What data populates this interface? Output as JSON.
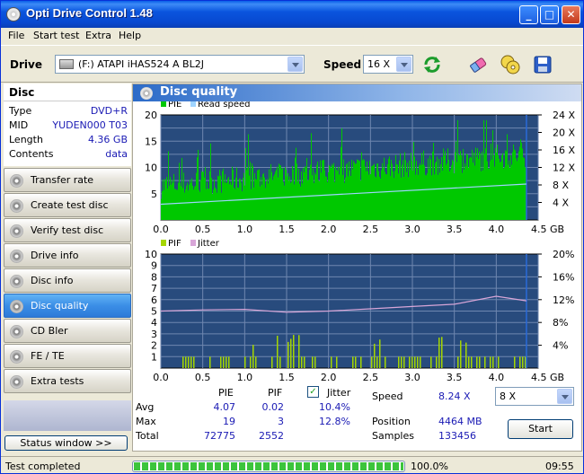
{
  "window": {
    "title": "Opti Drive Control 1.48",
    "minimize": "_",
    "maximize": "□",
    "close": "✕"
  },
  "menu": [
    "File",
    "Start test",
    "Extra",
    "Help"
  ],
  "toolbar": {
    "drive_label": "Drive",
    "drive_value": "(F:)  ATAPI iHAS524   A BL2J",
    "speed_label": "Speed",
    "speed_value": "16 X"
  },
  "disc": {
    "header": "Disc",
    "rows": [
      {
        "key": "Type",
        "value": "DVD+R"
      },
      {
        "key": "MID",
        "value": "YUDEN000 T03"
      },
      {
        "key": "Length",
        "value": "4.36 GB"
      },
      {
        "key": "Contents",
        "value": "data"
      }
    ]
  },
  "nav": [
    "Transfer rate",
    "Create test disc",
    "Verify test disc",
    "Drive info",
    "Disc info",
    "Disc quality",
    "CD Bler",
    "FE / TE",
    "Extra tests"
  ],
  "nav_active": "Disc quality",
  "status_window_button": "Status window >>",
  "panel_title": "Disc quality",
  "chart_data": [
    {
      "type": "bar",
      "legend": [
        "PIE",
        "Read speed"
      ],
      "colors": {
        "pie": "#00c800",
        "read_speed": "#9fd4ff",
        "background": "#284b7d",
        "grid": "#6f87b0"
      },
      "x_ticks": [
        "0.0",
        "0.5",
        "1.0",
        "1.5",
        "2.0",
        "2.5",
        "3.0",
        "3.5",
        "4.0",
        "4.5 GB"
      ],
      "y_left_ticks": [
        "20",
        "15",
        "10",
        "5"
      ],
      "y_right_ticks": [
        "24 X",
        "20 X",
        "16 X",
        "12 X",
        "8 X",
        "4 X"
      ],
      "xlim": [
        0,
        4.5
      ],
      "ylim": [
        0,
        20
      ],
      "y2lim": [
        0,
        24
      ],
      "read_speed": {
        "x": [
          0,
          4.36
        ],
        "y": [
          3.6,
          8.2
        ]
      }
    },
    {
      "type": "bar",
      "legend": [
        "PIF",
        "Jitter"
      ],
      "colors": {
        "pif": "#a5d600",
        "jitter": "#d8a6d8",
        "background": "#284b7d",
        "grid": "#6f87b0"
      },
      "x_ticks": [
        "0.0",
        "0.5",
        "1.0",
        "1.5",
        "2.0",
        "2.5",
        "3.0",
        "3.5",
        "4.0",
        "4.5 GB"
      ],
      "y_left_ticks": [
        "10",
        "9",
        "8",
        "7",
        "6",
        "5",
        "4",
        "3",
        "2",
        "1"
      ],
      "y_right_ticks": [
        "20%",
        "16%",
        "12%",
        "8%",
        "4%"
      ],
      "xlim": [
        0,
        4.5
      ],
      "ylim": [
        0,
        10
      ],
      "y2lim": [
        0,
        20
      ],
      "jitter": {
        "x": [
          0,
          0.5,
          1.0,
          1.5,
          2.0,
          2.5,
          3.0,
          3.5,
          4.0,
          4.36
        ],
        "y": [
          10.0,
          10.2,
          10.3,
          9.8,
          10.0,
          10.4,
          10.8,
          11.2,
          12.6,
          11.8
        ]
      }
    }
  ],
  "stats": {
    "col_pie": "PIE",
    "col_pif": "PIF",
    "col_jitter": "Jitter",
    "jitter_checked": "✓",
    "rows": [
      {
        "label": "Avg",
        "pie": "4.07",
        "pif": "0.02",
        "jitter": "10.4%"
      },
      {
        "label": "Max",
        "pie": "19",
        "pif": "3",
        "jitter": "12.8%"
      },
      {
        "label": "Total",
        "pie": "72775",
        "pif": "2552",
        "jitter": ""
      }
    ],
    "speed_label": "Speed",
    "speed_value": "8.24 X",
    "speed_select": "8 X",
    "position_label": "Position",
    "position_value": "4464 MB",
    "samples_label": "Samples",
    "samples_value": "133456",
    "start_button": "Start"
  },
  "statusbar": {
    "text": "Test completed",
    "progress": 100.0,
    "progress_label": "100.0%",
    "time": "09:55"
  }
}
